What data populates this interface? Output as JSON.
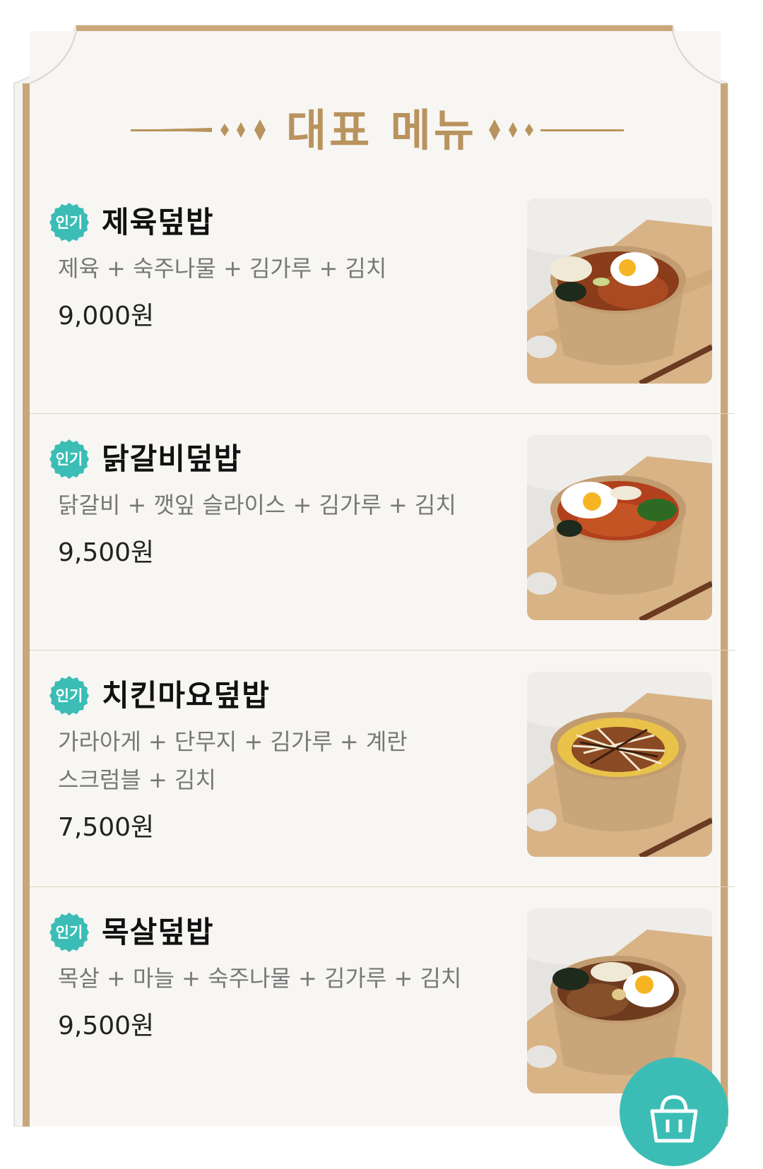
{
  "section": {
    "title": "대표 메뉴"
  },
  "menu": {
    "items": [
      {
        "badge": "인기",
        "name": "제육덮밥",
        "description_lines": [
          "제육 + 숙주나물 + 김가루 + 김치"
        ],
        "price": "9,000원"
      },
      {
        "badge": "인기",
        "name": "닭갈비덮밥",
        "description_lines": [
          "닭갈비 + 깻잎 슬라이스 + 김가루 + 김치"
        ],
        "price": "9,500원"
      },
      {
        "badge": "인기",
        "name": "치킨마요덮밥",
        "description_lines": [
          "가라아게 + 단무지 + 김가루 + 계란",
          "스크럼블 + 김치"
        ],
        "price": "7,500원"
      },
      {
        "badge": "인기",
        "name": "목살덮밥",
        "description_lines": [
          "목살 + 마늘 + 숙주나물 + 김가루 + 김치"
        ],
        "price": "9,500원"
      }
    ]
  },
  "fab": {
    "icon": "shopping-bag-icon"
  },
  "colors": {
    "accent_gold": "#b9935e",
    "badge_teal": "#3bbdb5",
    "paper": "#f7f6f3"
  }
}
